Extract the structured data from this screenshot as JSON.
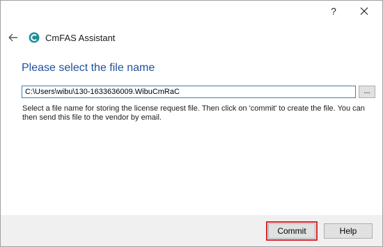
{
  "titlebar": {
    "help_glyph": "?",
    "close_icon": "close-icon"
  },
  "header": {
    "back_icon": "back-arrow-icon",
    "app_icon": "cmfas-logo-icon",
    "app_title": "CmFAS Assistant"
  },
  "main": {
    "heading": "Please select the file name",
    "file_path_value": "C:\\Users\\wibu\\130-1633636009.WibuCmRaC",
    "browse_label": "...",
    "description": "Select a file name for storing the license request file. Then click on 'commit' to create the file. You can then send this file to the vendor by email."
  },
  "footer": {
    "commit_label": "Commit",
    "help_label": "Help"
  },
  "colors": {
    "heading": "#1d4f9c",
    "highlight_border": "#d9262d",
    "input_border": "#3c7fb1",
    "footer_bg": "#f0f0f0"
  }
}
